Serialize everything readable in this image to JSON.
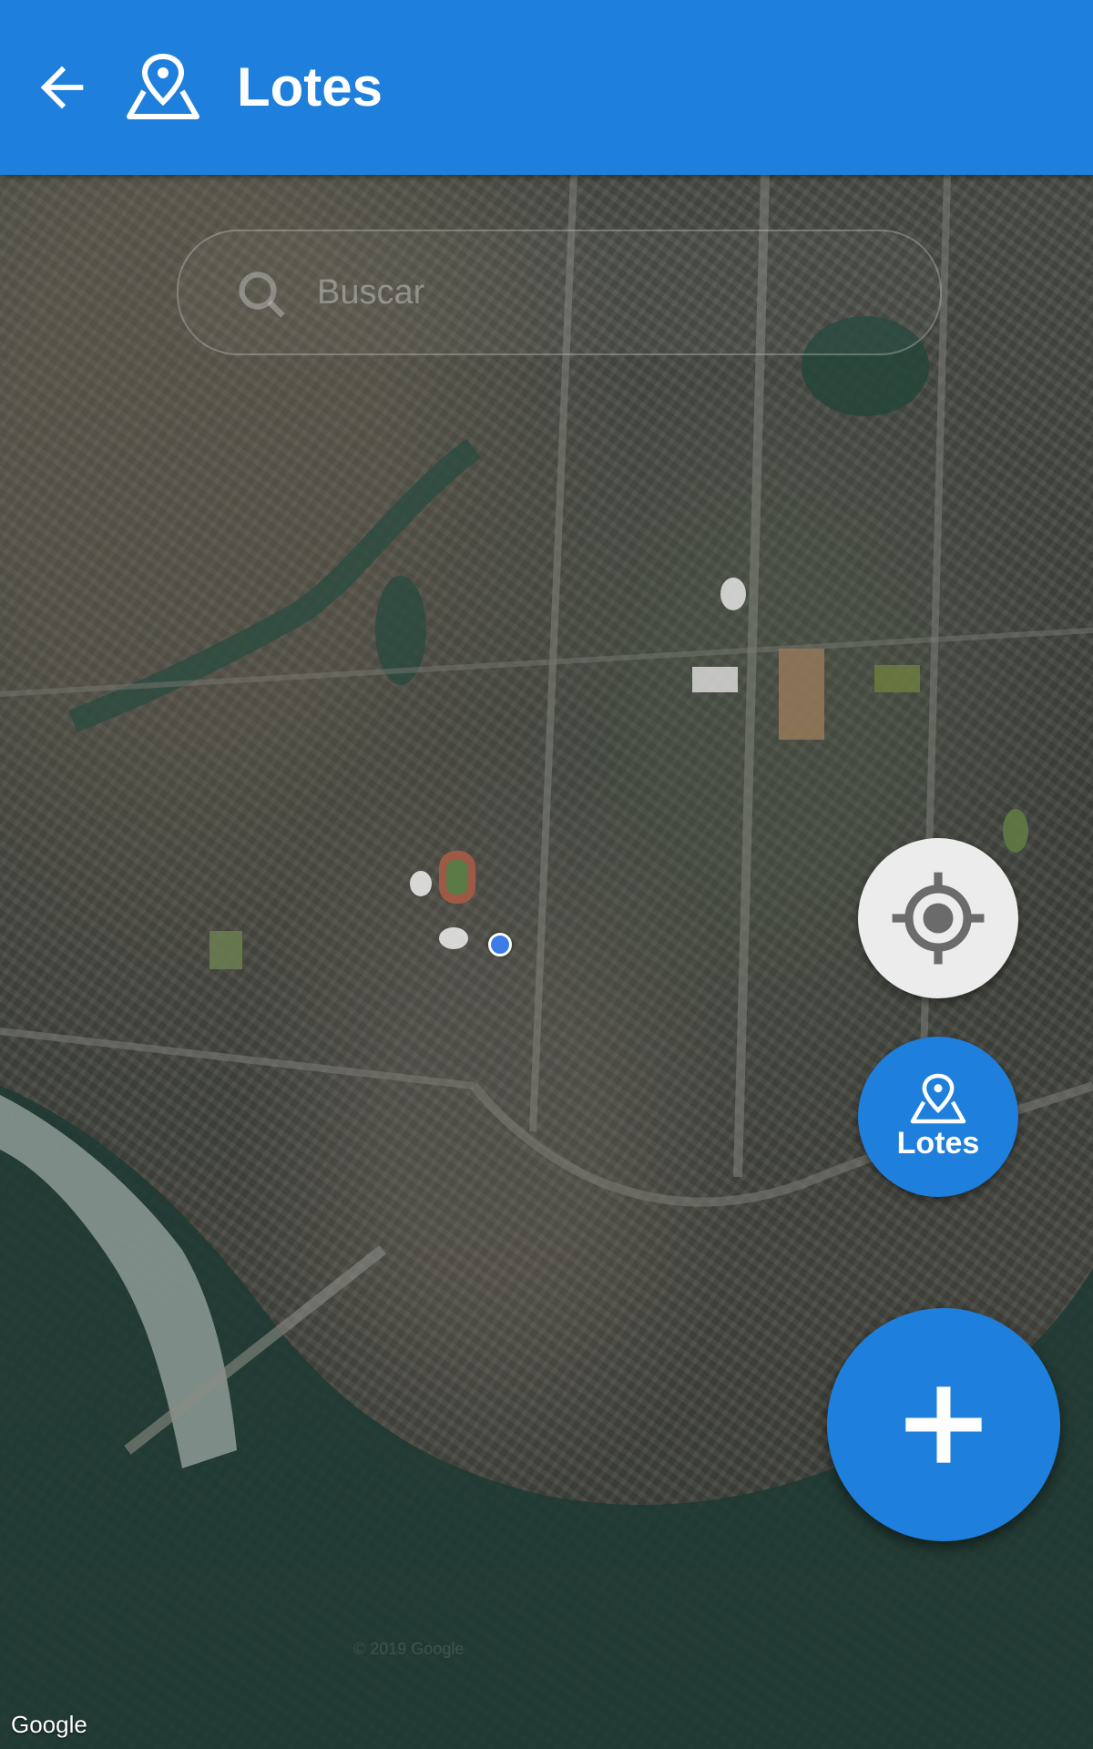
{
  "appbar": {
    "title": "Lotes",
    "back_icon": "arrow-left-icon",
    "title_icon": "map-pin-icon",
    "color": "#1e7fdc"
  },
  "search": {
    "placeholder": "Buscar",
    "icon": "search-icon"
  },
  "map": {
    "type": "satellite",
    "attribution": "Google",
    "copyright": "© 2019 Google"
  },
  "fabs": {
    "my_location_icon": "crosshair-icon",
    "lotes_label": "Lotes",
    "lotes_icon": "map-pin-icon",
    "add_icon": "plus-icon"
  }
}
